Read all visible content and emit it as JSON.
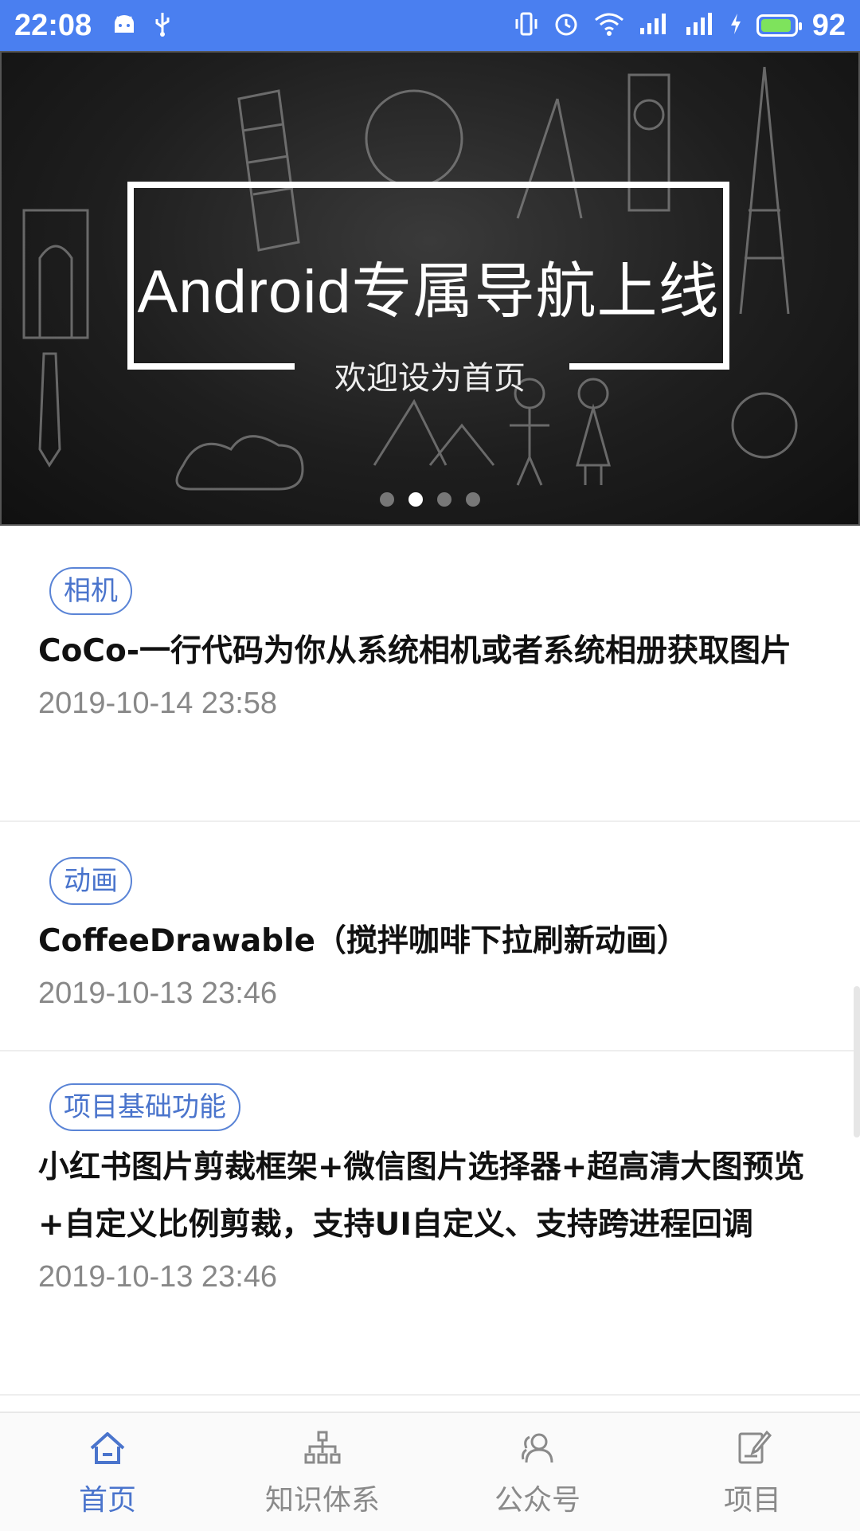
{
  "status_bar": {
    "time": "22:08",
    "battery_level": "92",
    "colors": {
      "background": "#4a7ff0"
    }
  },
  "banner": {
    "title": "Android专属导航上线",
    "subtitle": "欢迎设为首页",
    "indicator_count": 4,
    "indicator_active_index": 1
  },
  "articles": [
    {
      "tag": "相机",
      "title": "CoCo-一行代码为你从系统相机或者系统相册获取图片",
      "date": "2019-10-14 23:58"
    },
    {
      "tag": "动画",
      "title": "CoffeeDrawable（搅拌咖啡下拉刷新动画）",
      "date": "2019-10-13 23:46"
    },
    {
      "tag": "项目基础功能",
      "title": "小红书图片剪裁框架+微信图片选择器+超高清大图预览+自定义比例剪裁，支持UI自定义、支持跨进程回调",
      "date": "2019-10-13 23:46"
    }
  ],
  "bottom_nav": {
    "items": [
      {
        "label": "首页",
        "icon": "home-icon",
        "active": true
      },
      {
        "label": "知识体系",
        "icon": "hierarchy-icon",
        "active": false
      },
      {
        "label": "公众号",
        "icon": "people-icon",
        "active": false
      },
      {
        "label": "项目",
        "icon": "notebook-icon",
        "active": false
      }
    ],
    "colors": {
      "active": "#4a74cc",
      "inactive": "#8a8a8a"
    }
  }
}
